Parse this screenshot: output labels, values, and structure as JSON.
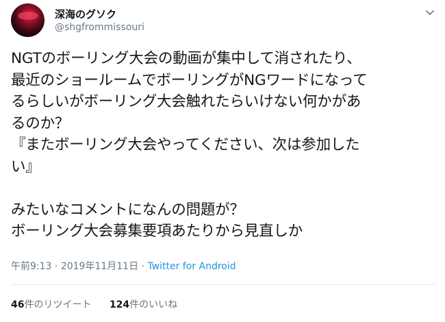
{
  "author": {
    "display_name": "深海のグソク",
    "handle": "@shgfrommissouri"
  },
  "tweet": {
    "lines": [
      "NGTのボーリング大会の動画が集中して消されたり、",
      "最近のショールームでボーリングがNGワードになって",
      "るらしいがボーリング大会触れたらいけない何かがあ",
      "るのか？",
      "『またボーリング大会やってください、次は参加した",
      "い』",
      "",
      "みたいなコメントになんの問題が？",
      "ボーリング大会募集要項あたりから見直しか"
    ]
  },
  "meta": {
    "time": "午前9:13",
    "separator1": " · ",
    "date": "2019年11月11日",
    "separator2": " · ",
    "source": "Twitter for Android"
  },
  "stats": {
    "retweets_count": "46",
    "retweets_label": "件のリツイート",
    "likes_count": "124",
    "likes_label": "件のいいね"
  },
  "icons": {
    "caret": "chevron-down-icon"
  },
  "colors": {
    "text": "#14171a",
    "secondary": "#657786",
    "link": "#1b95e0"
  }
}
